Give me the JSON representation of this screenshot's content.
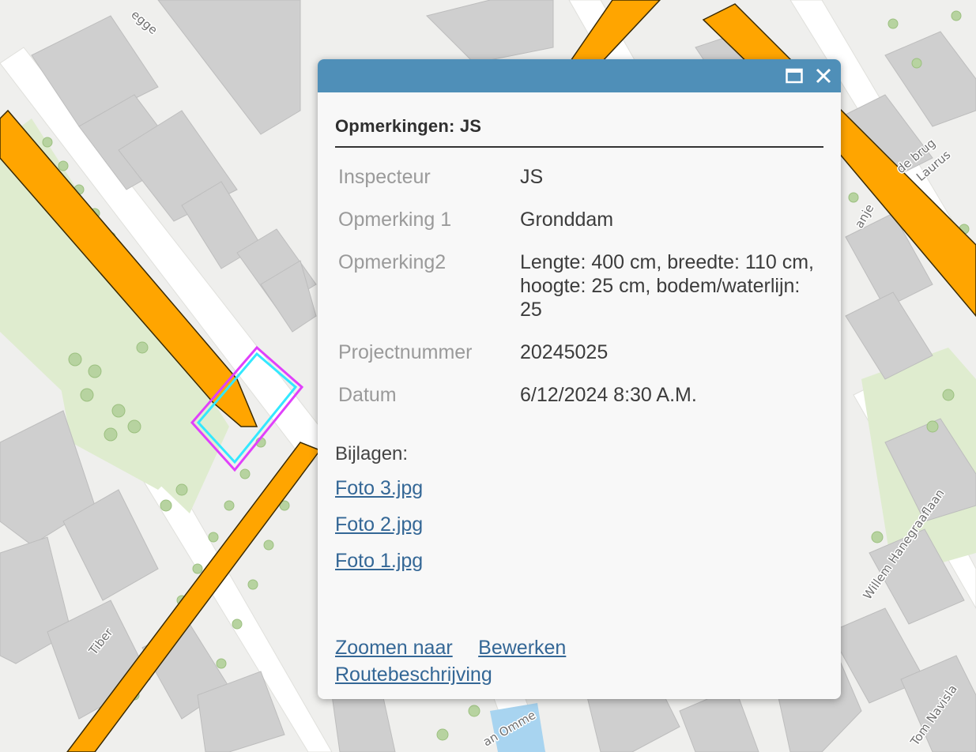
{
  "map": {
    "street_labels": [
      "Tiber",
      "egge",
      "de brug",
      "Laurus",
      "Willem Hanegraaflaan",
      "Tom Navisla",
      "anje",
      "an Omme"
    ],
    "colors": {
      "water": "#ffa500",
      "water_outline": "#3a2a00",
      "park": "#dfeccf",
      "tree": "#b7d3a0",
      "building": "#cfcfcf",
      "road": "#ffffff",
      "selection_outer": "#e040fb",
      "selection_inner": "#33e8ff"
    }
  },
  "popup": {
    "title": "Opmerkingen: JS",
    "header_color": "#4f8fb8",
    "icons": {
      "maximize": "maximize-icon",
      "close": "close-icon"
    },
    "fields": [
      {
        "name": "Inspecteur",
        "value": "JS"
      },
      {
        "name": "Opmerking 1",
        "value": "Gronddam"
      },
      {
        "name": "Opmerking2",
        "value": "Lengte: 400 cm, breedte: 110 cm, hoogte: 25 cm, bodem/waterlijn: 25"
      },
      {
        "name": "Projectnummer",
        "value": "20245025"
      },
      {
        "name": "Datum",
        "value": "6/12/2024 8:30 A.M."
      }
    ],
    "attachments_label": "Bijlagen:",
    "attachments": [
      "Foto 3.jpg",
      "Foto 2.jpg",
      "Foto 1.jpg"
    ],
    "actions": {
      "zoom": "Zoomen naar",
      "edit": "Bewerken",
      "directions": "Routebeschrijving"
    }
  }
}
